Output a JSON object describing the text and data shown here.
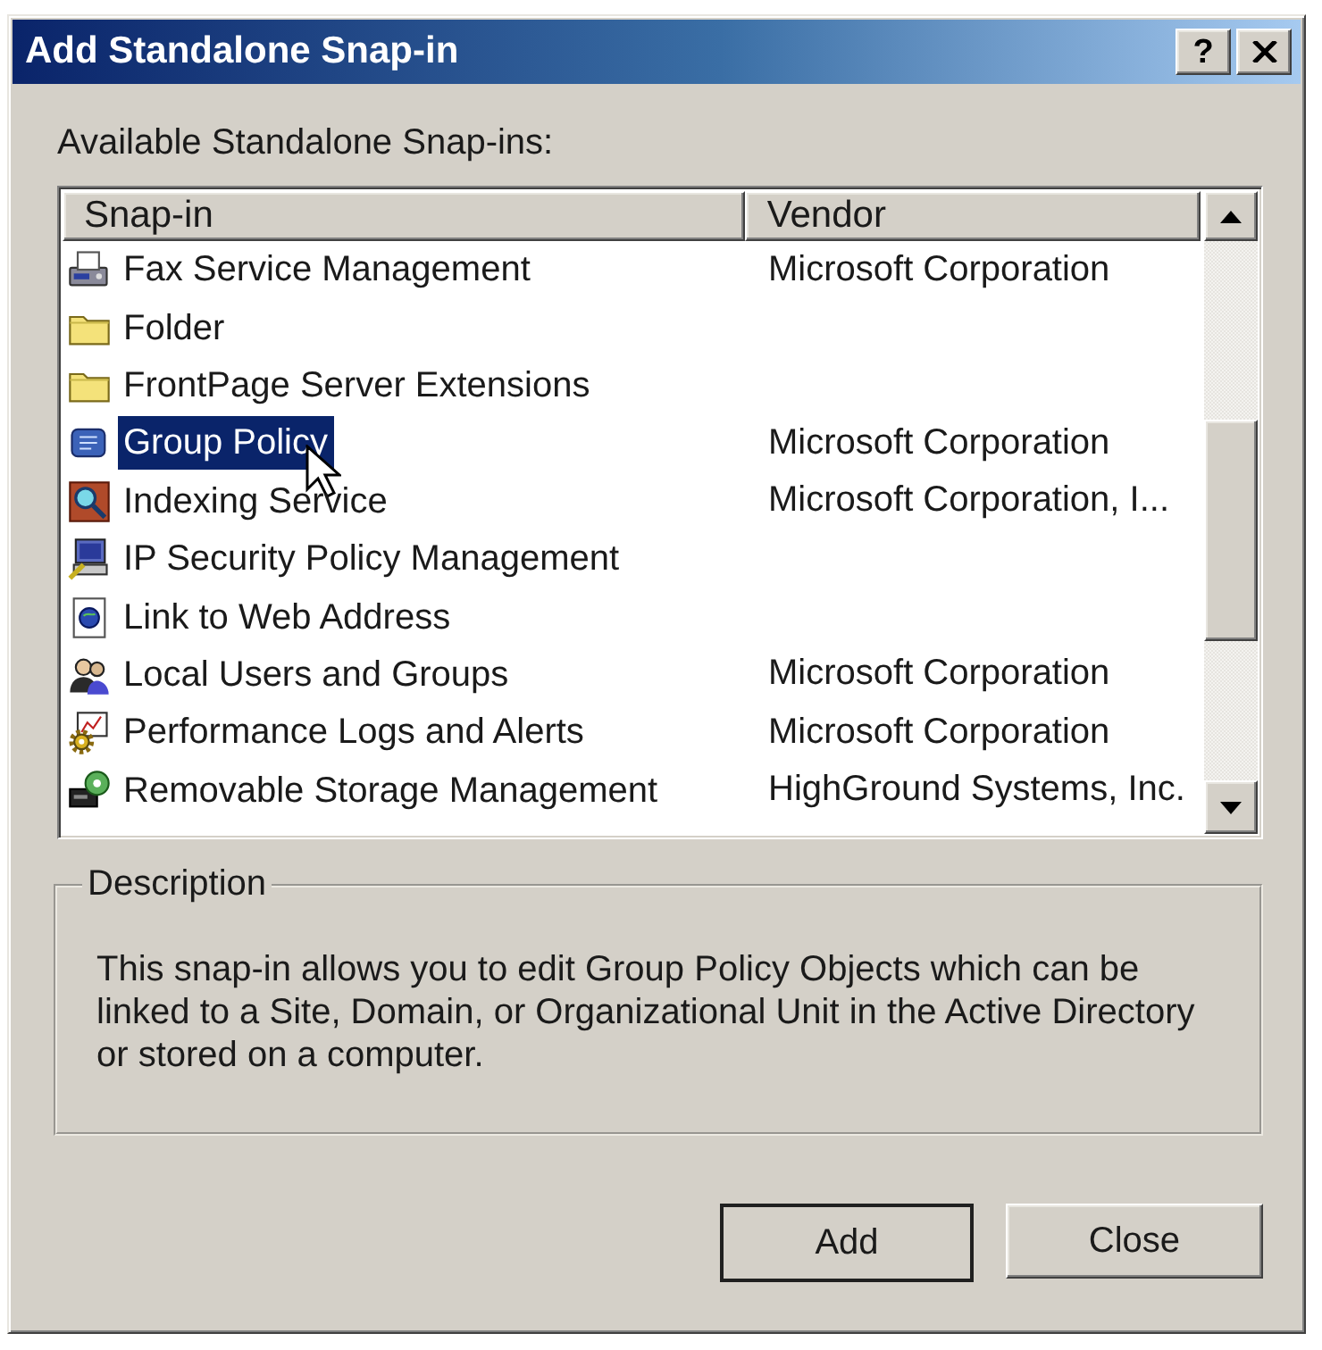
{
  "window": {
    "title": "Add Standalone Snap-in",
    "help_button": "?"
  },
  "list_label": "Available Standalone Snap-ins:",
  "list": {
    "columns": [
      "Snap-in",
      "Vendor"
    ],
    "rows": [
      {
        "name": "Fax Service Management",
        "vendor": "Microsoft Corporation",
        "kind": "fax",
        "selected": false
      },
      {
        "name": "Folder",
        "kind": "folder",
        "selected": false
      },
      {
        "name": "FrontPage Server Extensions",
        "kind": "folder",
        "selected": false
      },
      {
        "name": "Group Policy",
        "vendor": "Microsoft Corporation",
        "kind": "policy",
        "selected": true
      },
      {
        "name": "Indexing Service",
        "vendor": "Microsoft Corporation, I...",
        "kind": "indexing",
        "selected": false
      },
      {
        "name": "IP Security Policy Management",
        "kind": "security",
        "selected": false
      },
      {
        "name": "Link to Web Address",
        "kind": "link",
        "selected": false
      },
      {
        "name": "Local Users and Groups",
        "vendor": "Microsoft Corporation",
        "kind": "users",
        "selected": false
      },
      {
        "name": "Performance Logs and Alerts",
        "vendor": "Microsoft Corporation",
        "kind": "performance",
        "selected": false
      },
      {
        "name": "Removable Storage Management",
        "vendor": "HighGround Systems, Inc.",
        "kind": "storage",
        "selected": false
      }
    ]
  },
  "description": {
    "label": "Description",
    "text": "This snap-in allows you to edit Group Policy Objects which can be linked to a Site, Domain, or Organizational Unit in the Active Directory or stored on a computer."
  },
  "buttons": [
    {
      "label": "Add",
      "default": true
    },
    {
      "label": "Close",
      "default": false
    }
  ]
}
